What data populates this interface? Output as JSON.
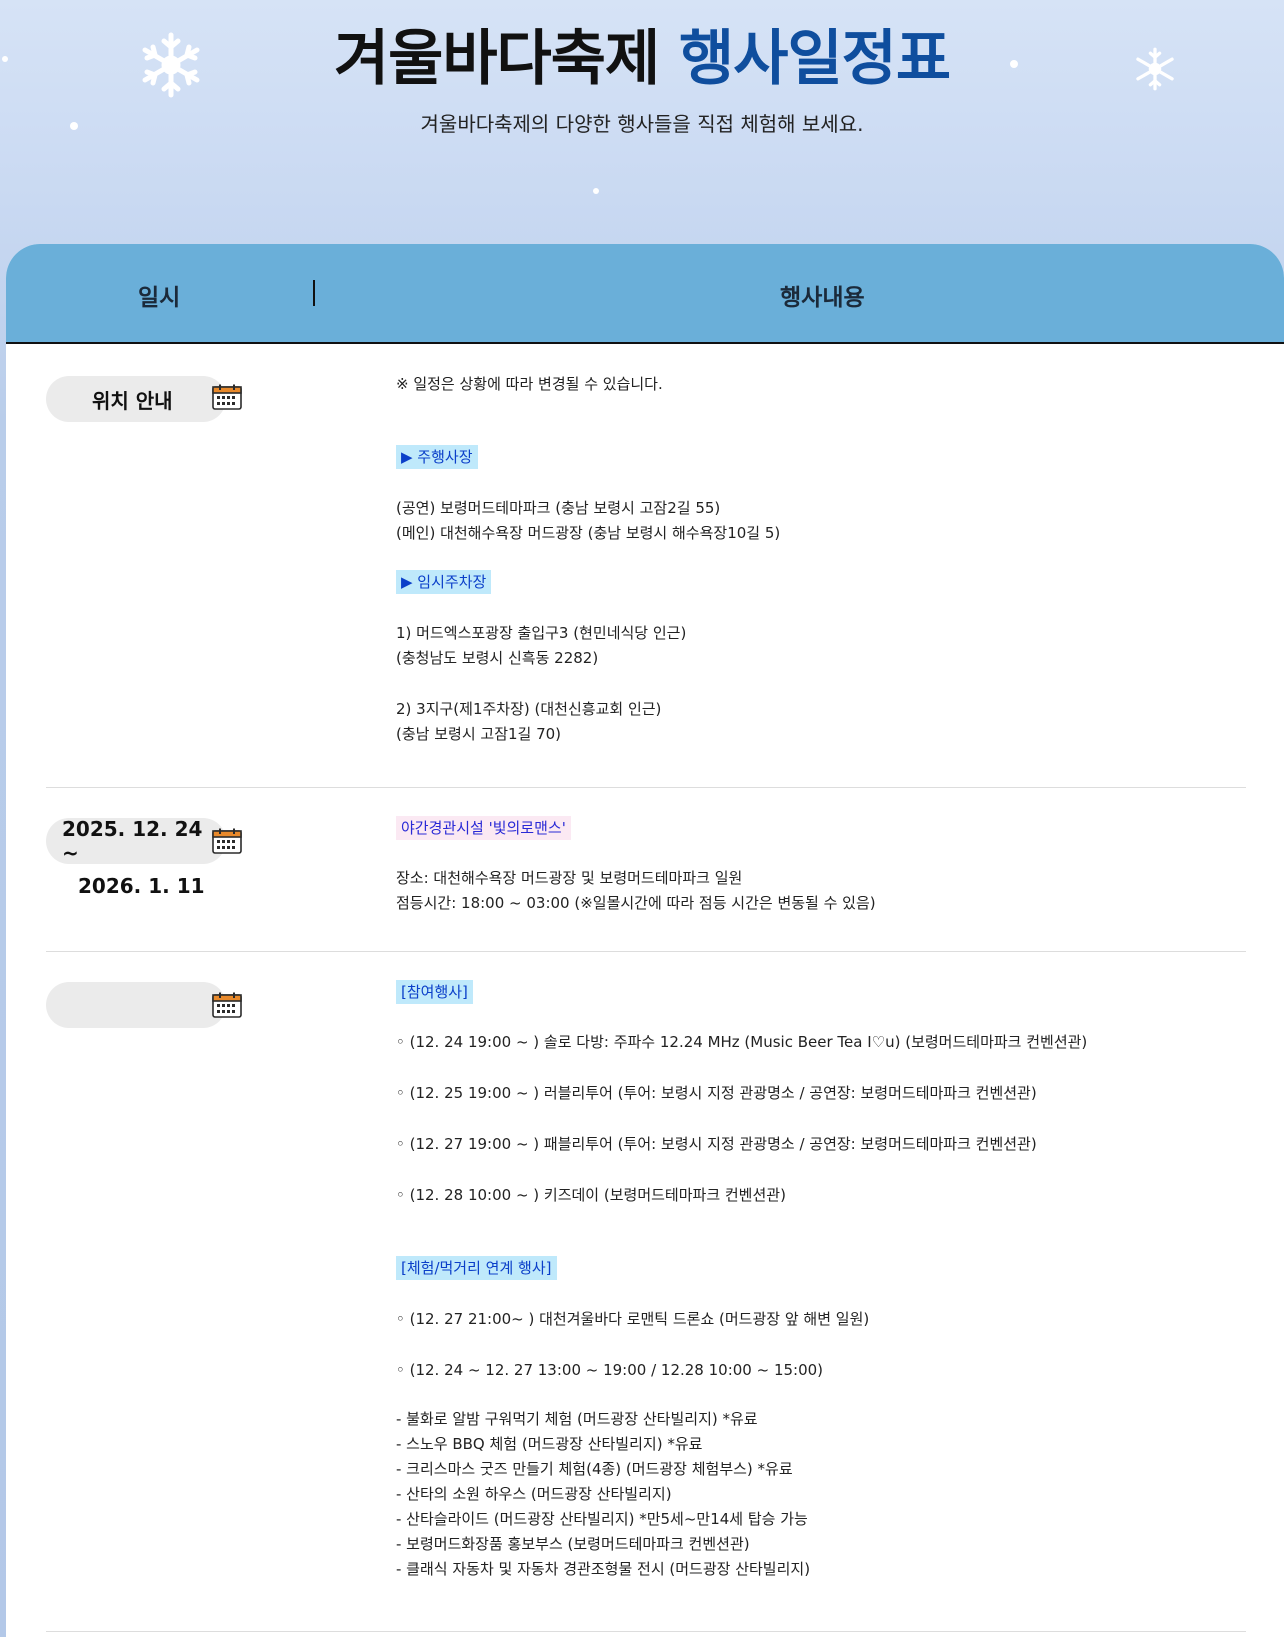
{
  "hero": {
    "title_main": "겨울바다축제",
    "title_accent": "행사일정표",
    "subtitle": "겨울바다축제의 다양한 행사들을 직접 체험해 보세요."
  },
  "table": {
    "col_date": "일시",
    "col_content": "행사내용"
  },
  "rows": [
    {
      "label": "위치 안내",
      "notice": "※ 일정은 상황에 따라 변경될 수 있습니다.",
      "section1": "▶ 주행사장",
      "venue1": "(공연) 보령머드테마파크 (충남 보령시 고잠2길 55)",
      "venue2": "(메인) 대천해수욕장 머드광장 (충남 보령시 해수욕장10길 5)",
      "section2": "▶ 임시주차장",
      "park1a": "1) 머드엑스포광장 출입구3 (현민네식당 인근)",
      "park1b": "(충청남도 보령시 신흑동 2282)",
      "park2a": "2) 3지구(제1주차장) (대천신흥교회 인근)",
      "park2b": "(충남 보령시 고잠1길 70)"
    },
    {
      "date_start": "2025. 12. 24 ~",
      "date_end": "2026. 1. 11",
      "title": "야간경관시설 '빛의로맨스'",
      "place": "장소: 대천해수욕장 머드광장 및 보령머드테마파크 일원",
      "hours": "점등시간: 18:00 ~ 03:00 (※일몰시간에 따라 점등 시간은 변동될 수 있음)"
    },
    {
      "label": "",
      "section1": "[참여행사]",
      "events": [
        "◦ (12. 24 19:00 ~ ) 솔로 다방: 주파수 12.24 MHz (Music Beer Tea I♡u) (보령머드테마파크 컨벤션관)",
        "◦ (12. 25 19:00 ~ )  러블리투어 (투어: 보령시 지정 관광명소 / 공연장: 보령머드테마파크 컨벤션관)",
        "◦ (12. 27 19:00 ~ ) 패블리투어  (투어: 보령시 지정 관광명소 / 공연장: 보령머드테마파크 컨벤션관)",
        "◦ (12. 28 10:00 ~ ) 키즈데이 (보령머드테마파크 컨벤션관)"
      ],
      "section2": "[체험/먹거리 연계 행사]",
      "drone": "◦ (12. 27 21:00~ ) 대천겨울바다 로맨틱 드론쇼 (머드광장 앞 해변 일원)",
      "period": "◦ (12. 24 ~ 12. 27 13:00 ~ 19:00 / 12.28 10:00 ~ 15:00)",
      "items": [
        "- 불화로 알밤 구워먹기 체험 (머드광장 산타빌리지) *유료",
        "- 스노우 BBQ 체험 (머드광장 산타빌리지) *유료",
        "- 크리스마스 굿즈 만들기 체험(4종) (머드광장 체험부스) *유료",
        "- 산타의 소원 하우스  (머드광장 산타빌리지)",
        "- 산타슬라이드 (머드광장 산타빌리지) *만5세~만14세 탑승 가능",
        "- 보령머드화장품 홍보부스 (보령머드테마파크 컨벤션관)",
        "- 클래식 자동차 및 자동차 경관조형물 전시 (머드광장 산타빌리지)"
      ]
    }
  ],
  "colors": {
    "accent": "#0f4e9e",
    "header_bar": "#6aafd9",
    "tag_bg": "#bfe9fb",
    "calendar": "#e8892b"
  }
}
